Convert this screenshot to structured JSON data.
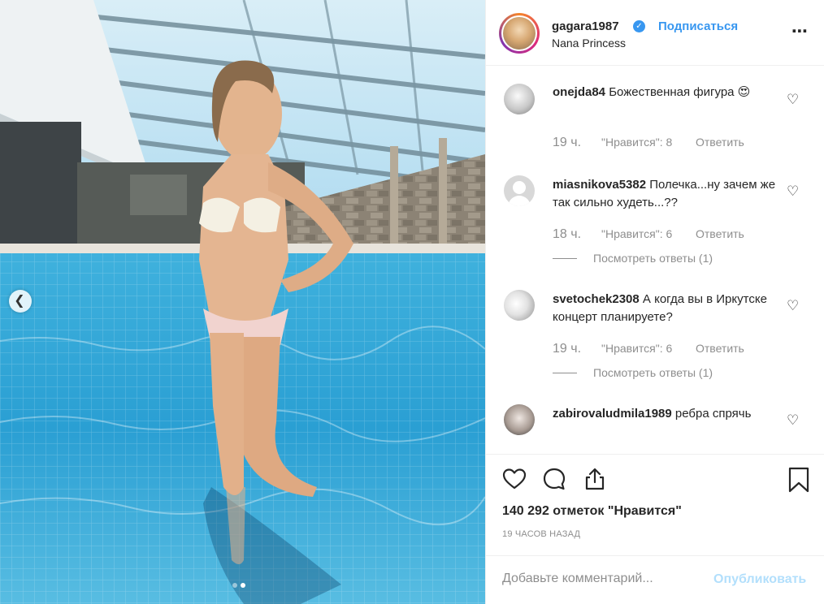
{
  "post": {
    "username": "gagara1987",
    "follow_label": "Подписаться",
    "location": "Nana Princess",
    "more_icon": "ellipsis-icon",
    "verified_icon": "verified-badge-icon"
  },
  "comments": [
    {
      "username": "onejda84",
      "text": "Божественная фигура 😍",
      "time": "19 ч.",
      "likes": "\"Нравится\": 8",
      "reply": "Ответить",
      "view_replies": ""
    },
    {
      "username": "miasnikova5382",
      "text": "Полечка...ну зачем же так сильно худеть...??",
      "time": "18 ч.",
      "likes": "\"Нравится\": 6",
      "reply": "Ответить",
      "view_replies": "Посмотреть ответы (1)"
    },
    {
      "username": "svetochek2308",
      "text": "А когда вы в Иркутске концерт планируете?",
      "time": "19 ч.",
      "likes": "\"Нравится\": 6",
      "reply": "Ответить",
      "view_replies": "Посмотреть ответы (1)"
    },
    {
      "username": "zabirovaludmila1989",
      "text": "ребра спрячь",
      "time": "",
      "likes": "",
      "reply": "",
      "view_replies": ""
    }
  ],
  "actions": {
    "like_icon": "heart-icon",
    "comment_icon": "comment-icon",
    "share_icon": "share-icon",
    "save_icon": "bookmark-icon",
    "likes_count": "140 292 отметок \"Нравится\"",
    "timestamp": "19 ЧАСОВ НАЗАД"
  },
  "add_comment": {
    "placeholder": "Добавьте комментарий...",
    "publish_label": "Опубликовать"
  },
  "carousel": {
    "prev_icon": "chevron-left-icon",
    "slide_count": 2,
    "active_slide": 2
  },
  "colors": {
    "link": "#3897f0",
    "publish_disabled": "#b2dffc",
    "muted": "#8e8e8e",
    "text": "#262626"
  }
}
